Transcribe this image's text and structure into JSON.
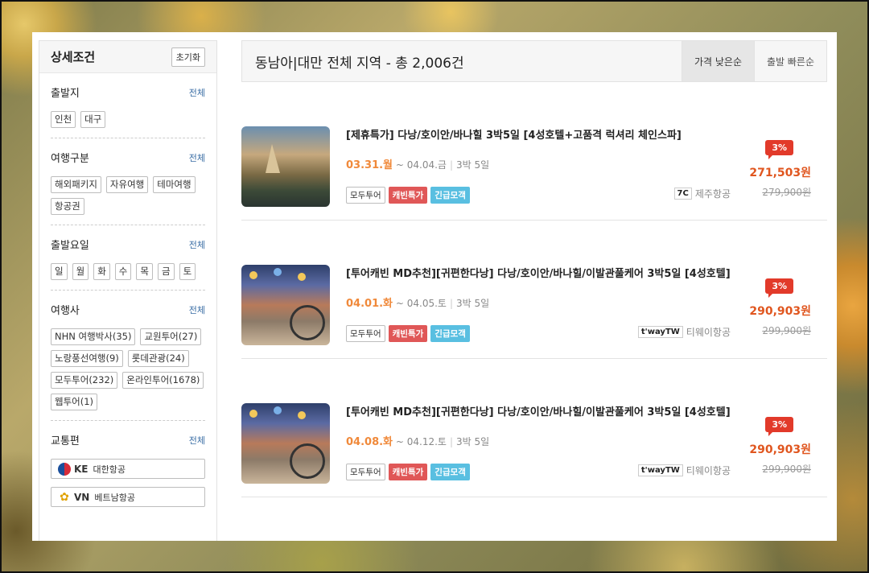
{
  "sidebar": {
    "title": "상세조건",
    "reset_label": "초기화",
    "all_label": "전체",
    "sections": {
      "departure": {
        "label": "출발지",
        "items": [
          "인천",
          "대구"
        ]
      },
      "trip_type": {
        "label": "여행구분",
        "items": [
          "해외패키지",
          "자유여행",
          "테마여행",
          "항공권"
        ]
      },
      "weekday": {
        "label": "출발요일",
        "items": [
          "일",
          "월",
          "화",
          "수",
          "목",
          "금",
          "토"
        ]
      },
      "agency": {
        "label": "여행사",
        "items": [
          "NHN 여행박사(35)",
          "교원투어(27)",
          "노랑풍선여행(9)",
          "롯데관광(24)",
          "모두투어(232)",
          "온라인투어(1678)",
          "웹투어(1)"
        ]
      },
      "transport": {
        "label": "교통편",
        "items": [
          {
            "code": "KE",
            "name": "대한항공",
            "icon": "korean-air-logo"
          },
          {
            "code": "VN",
            "name": "베트남항공",
            "icon": "vietnam-airlines-logo"
          }
        ]
      }
    }
  },
  "header": {
    "title": "동남아|대만 전체 지역 - 총 2,006건",
    "sort_options": [
      "가격 낮은순",
      "출발 빠른순"
    ],
    "active_sort": "가격 낮은순"
  },
  "products": [
    {
      "title": "[제휴특가] 다낭/호이안/바나힐 3박5일 [4성호텔+고품격 럭셔리 체인스파]",
      "start": "03.31.월",
      "end": "~ 04.04.금",
      "duration": "3박 5일",
      "tags": [
        "모두투어",
        "캐빈특가",
        "긴급모객"
      ],
      "airline_logo": "7C",
      "airline": "제주항공",
      "discount": "3%",
      "price": "271,503원",
      "original_price": "279,900원"
    },
    {
      "title": "[투어캐빈 MD추천][귀편한다낭] 다낭/호이안/바나힐/이발관풀케어 3박5일 [4성호텔]",
      "start": "04.01.화",
      "end": "~ 04.05.토",
      "duration": "3박 5일",
      "tags": [
        "모두투어",
        "캐빈특가",
        "긴급모객"
      ],
      "airline_logo": "t'wayTW",
      "airline": "티웨이항공",
      "discount": "3%",
      "price": "290,903원",
      "original_price": "299,900원"
    },
    {
      "title": "[투어캐빈 MD추천][귀편한다낭] 다낭/호이안/바나힐/이발관풀케어 3박5일 [4성호텔]",
      "start": "04.08.화",
      "end": "~ 04.12.토",
      "duration": "3박 5일",
      "tags": [
        "모두투어",
        "캐빈특가",
        "긴급모객"
      ],
      "airline_logo": "t'wayTW",
      "airline": "티웨이항공",
      "discount": "3%",
      "price": "290,903원",
      "original_price": "299,900원"
    }
  ],
  "colors": {
    "price": "#e0561f",
    "start_date": "#f0893a",
    "tag_cabin": "#e05757",
    "tag_urgent": "#59bfe1",
    "badge": "#e23a2a"
  }
}
